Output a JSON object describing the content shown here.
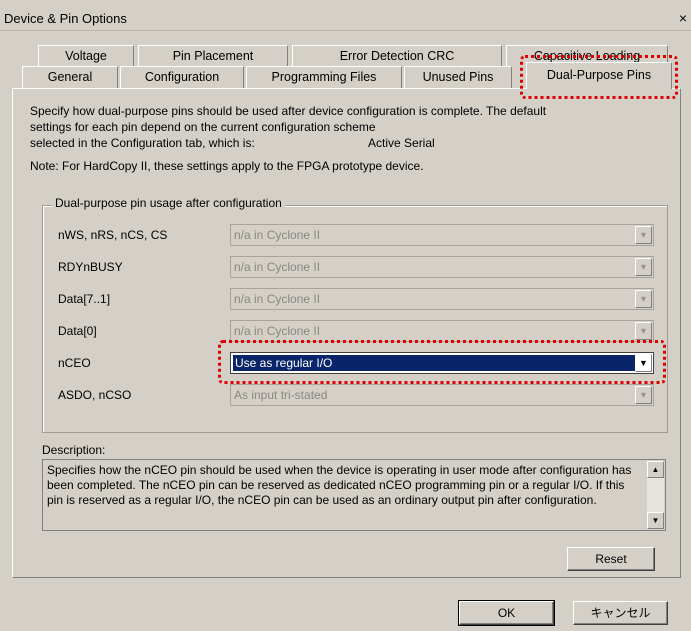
{
  "window": {
    "title": "Device & Pin Options",
    "close_glyph": "×"
  },
  "tabs": {
    "row1": [
      "Voltage",
      "Pin Placement",
      "Error Detection CRC",
      "Capacitive Loading"
    ],
    "row2": [
      "General",
      "Configuration",
      "Programming Files",
      "Unused Pins",
      "Dual-Purpose Pins"
    ],
    "active": "Dual-Purpose Pins"
  },
  "intro": {
    "line1": "Specify how dual-purpose pins should be used after device configuration is complete. The default",
    "line2": "settings for each pin depend on the current configuration scheme",
    "line3": "selected in the Configuration tab, which is:",
    "scheme": "Active Serial",
    "note": "Note: For HardCopy II, these settings apply to the FPGA prototype device."
  },
  "group": {
    "legend": "Dual-purpose pin usage after configuration",
    "rows": [
      {
        "label": "nWS, nRS, nCS, CS",
        "value": "n/a in Cyclone II"
      },
      {
        "label": "RDYnBUSY",
        "value": "n/a in Cyclone II"
      },
      {
        "label": "Data[7..1]",
        "value": "n/a in Cyclone II"
      },
      {
        "label": "Data[0]",
        "value": "n/a in Cyclone II"
      },
      {
        "label": "nCEO",
        "value": "Use as regular I/O"
      },
      {
        "label": "ASDO, nCSO",
        "value": "As input tri-stated"
      }
    ]
  },
  "description": {
    "label": "Description:",
    "text": "Specifies how the nCEO pin should be used when the device is operating in user mode after configuration has been completed. The nCEO pin can be reserved as dedicated nCEO programming pin or a regular I/O. If this pin is reserved as a regular I/O, the nCEO pin can be used as an ordinary output pin after configuration."
  },
  "buttons": {
    "reset": "Reset",
    "ok": "OK",
    "cancel": "キャンセル"
  },
  "icons": {
    "dropdown": "chevron-down-icon",
    "scroll_up": "arrow-up-icon",
    "scroll_down": "arrow-down-icon"
  },
  "colors": {
    "face": "#d4d0c8",
    "selection": "#0a246a",
    "highlight": "#e00000"
  }
}
